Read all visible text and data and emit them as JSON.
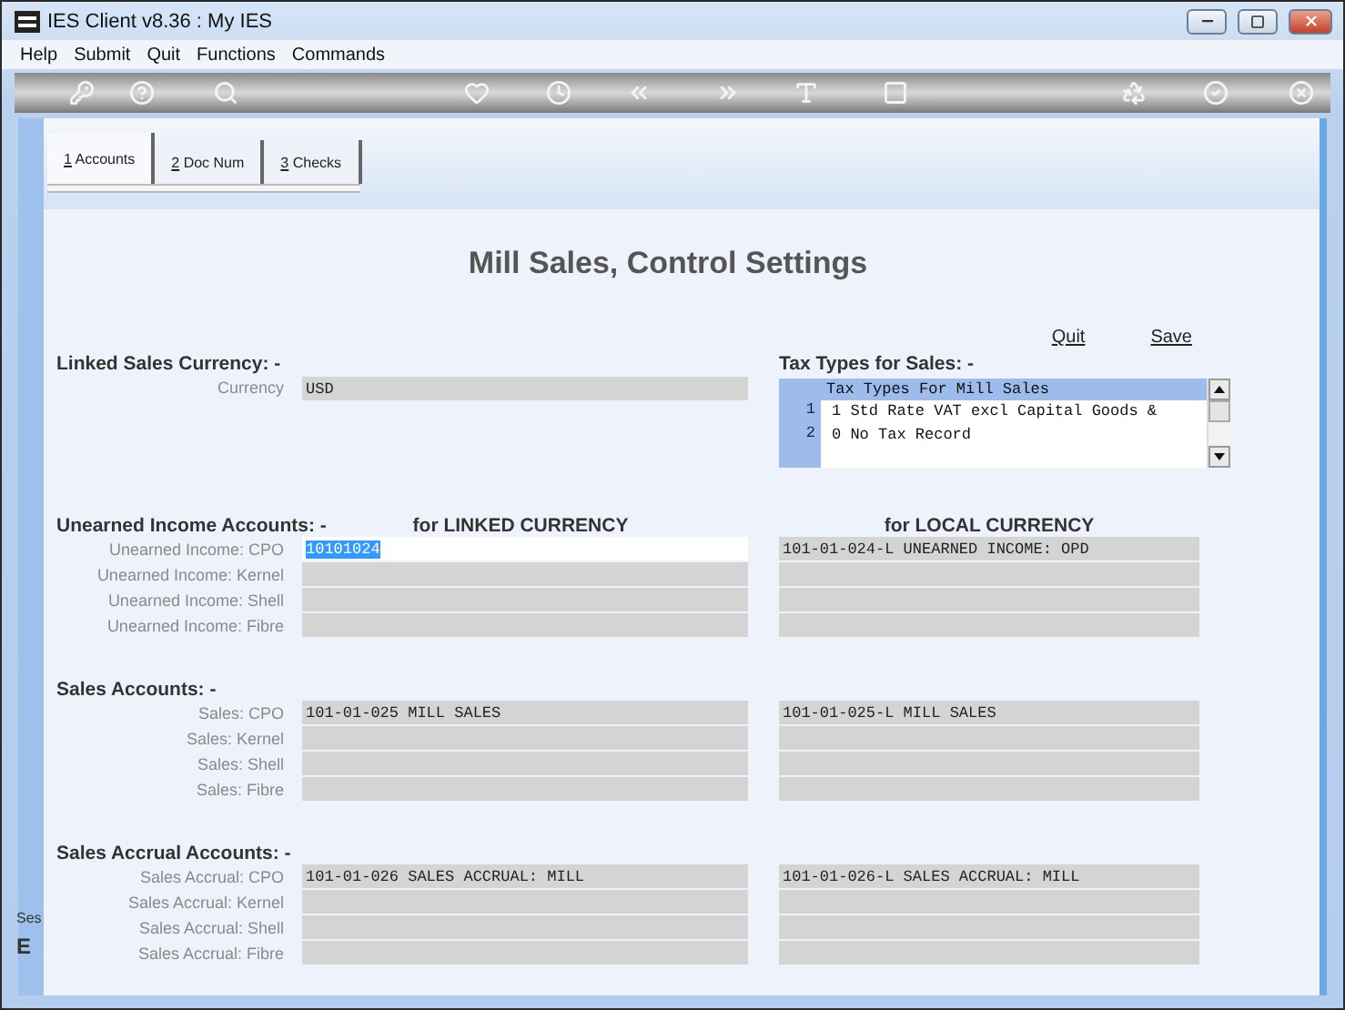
{
  "window": {
    "title": "IES Client v8.36 : My IES"
  },
  "menu": [
    "Help",
    "Submit",
    "Quit",
    "Functions",
    "Commands"
  ],
  "tabs": [
    {
      "key": "1",
      "label": "Accounts",
      "selected": true
    },
    {
      "key": "2",
      "label": "Doc Num",
      "selected": false
    },
    {
      "key": "3",
      "label": "Checks",
      "selected": false
    }
  ],
  "page_title": "Mill Sales, Control Settings",
  "actions": [
    "Quit",
    "Save"
  ],
  "linked_currency": {
    "heading": "Linked Sales Currency: -",
    "label": "Currency",
    "value": "USD"
  },
  "tax_types": {
    "heading": "Tax Types for Sales: -",
    "list_header": "Tax Types For Mill Sales",
    "rows": [
      {
        "number": "1",
        "text": "1 Std Rate VAT excl Capital Goods &"
      },
      {
        "number": "2",
        "text": "0 No Tax Record"
      }
    ]
  },
  "sections": [
    {
      "heading": "Unearned Income Accounts: -",
      "linked_heading": "for LINKED CURRENCY",
      "local_heading": "for LOCAL CURRENCY",
      "rows": [
        {
          "label": "Unearned Income: CPO",
          "linked": "10101024",
          "local": "101-01-024-L UNEARNED INCOME: OPD",
          "focused": true
        },
        {
          "label": "Unearned Income: Kernel",
          "focused": false
        },
        {
          "label": "Unearned Income: Shell",
          "focused": false
        },
        {
          "label": "Unearned Income: Fibre",
          "focused": false
        }
      ]
    },
    {
      "heading": "Sales Accounts: -",
      "rows": [
        {
          "label": "Sales: CPO",
          "linked": "101-01-025 MILL SALES",
          "local": "101-01-025-L MILL SALES",
          "focused": false
        },
        {
          "label": "Sales: Kernel",
          "focused": false
        },
        {
          "label": "Sales: Shell",
          "focused": false
        },
        {
          "label": "Sales: Fibre",
          "focused": false
        }
      ]
    },
    {
      "heading": "Sales Accrual Accounts: -",
      "rows": [
        {
          "label": "Sales Accrual: CPO",
          "linked": "101-01-026 SALES ACCRUAL: MILL",
          "local": "101-01-026-L SALES ACCRUAL: MILL",
          "focused": false
        },
        {
          "label": "Sales Accrual: Kernel",
          "focused": false
        },
        {
          "label": "Sales Accrual: Shell",
          "focused": false
        },
        {
          "label": "Sales Accrual: Fibre",
          "focused": false
        }
      ]
    }
  ],
  "side_fragments": [
    "Ses",
    "E"
  ]
}
